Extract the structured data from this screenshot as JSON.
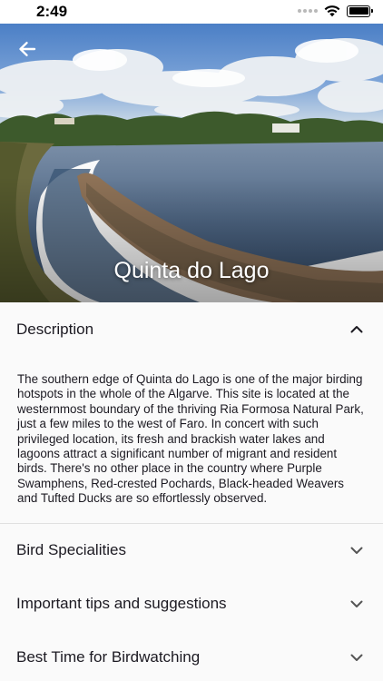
{
  "status_bar": {
    "time": "2:49",
    "icons": [
      "signal-dots-icon",
      "wifi-icon",
      "battery-icon"
    ]
  },
  "hero": {
    "title": "Quinta do Lago",
    "back_icon": "arrow-back-icon",
    "image": "lagoon-landscape"
  },
  "sections": [
    {
      "title": "Description",
      "expanded": true,
      "body": "The southern edge of Quinta do Lago is one of the major birding hotspots in the whole of the Algarve. This site is located at the westernmost boundary of the thriving Ria Formosa Natural Park, just a few miles to the west of Faro. In concert with such privileged location, its fresh and brackish water lakes and lagoons attract a significant number of migrant and resident birds. There's no other place in the country where Purple Swamphens, Red-crested Pochards, Black-headed Weavers and Tufted Ducks are so effortlessly observed."
    },
    {
      "title": "Bird Specialities",
      "expanded": false
    },
    {
      "title": "Important tips and suggestions",
      "expanded": false
    },
    {
      "title": "Best Time for Birdwatching",
      "expanded": false
    }
  ],
  "colors": {
    "background": "#fafafa",
    "text": "#1c1a22",
    "divider": "#e0e0e0"
  }
}
